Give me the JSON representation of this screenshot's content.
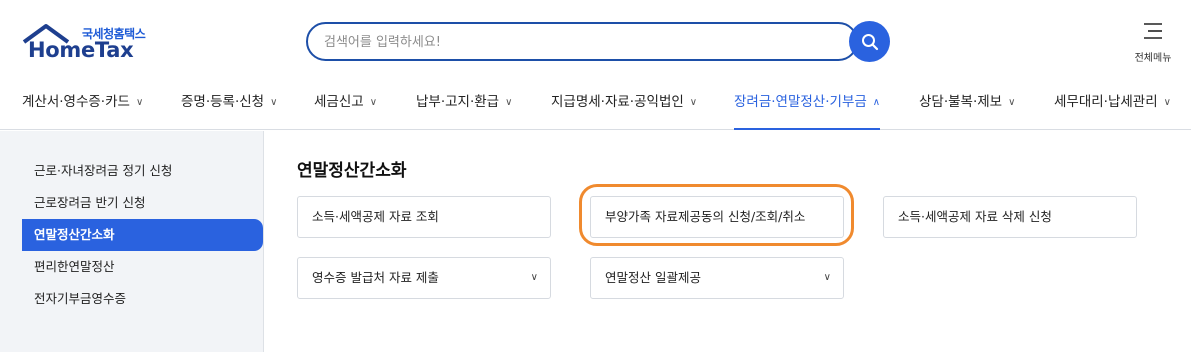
{
  "logo": {
    "sub": "국세청홈택스",
    "main": "HomeTax"
  },
  "search": {
    "placeholder": "검색어를 입력하세요!",
    "value": ""
  },
  "allmenu": {
    "label": "전체메뉴"
  },
  "gnb": [
    {
      "label": "계산서·영수증·카드",
      "chev": "∨"
    },
    {
      "label": "증명·등록·신청",
      "chev": "∨"
    },
    {
      "label": "세금신고",
      "chev": "∨"
    },
    {
      "label": "납부·고지·환급",
      "chev": "∨"
    },
    {
      "label": "지급명세·자료·공익법인",
      "chev": "∨"
    },
    {
      "label": "장려금·연말정산·기부금",
      "chev": "∧",
      "active": true
    },
    {
      "label": "상담·불복·제보",
      "chev": "∨"
    },
    {
      "label": "세무대리·납세관리",
      "chev": "∨"
    }
  ],
  "sidebar": {
    "items": [
      {
        "label": "근로·자녀장려금 정기 신청"
      },
      {
        "label": "근로장려금 반기 신청"
      },
      {
        "label": "연말정산간소화",
        "active": true
      },
      {
        "label": "편리한연말정산"
      },
      {
        "label": "전자기부금영수증"
      }
    ]
  },
  "main": {
    "title": "연말정산간소화",
    "cards": [
      {
        "label": "소득·세액공제 자료 조회"
      },
      {
        "label": "부양가족 자료제공동의 신청/조회/취소"
      },
      {
        "label": "소득·세액공제 자료 삭제 신청"
      },
      {
        "label": "영수증 발급처 자료 제출",
        "chev": "∨"
      },
      {
        "label": "연말정산 일괄제공",
        "chev": "∨"
      }
    ]
  },
  "colors": {
    "accent": "#2a62df",
    "highlight": "#f08a2e",
    "logo": "#1e3f8f"
  }
}
